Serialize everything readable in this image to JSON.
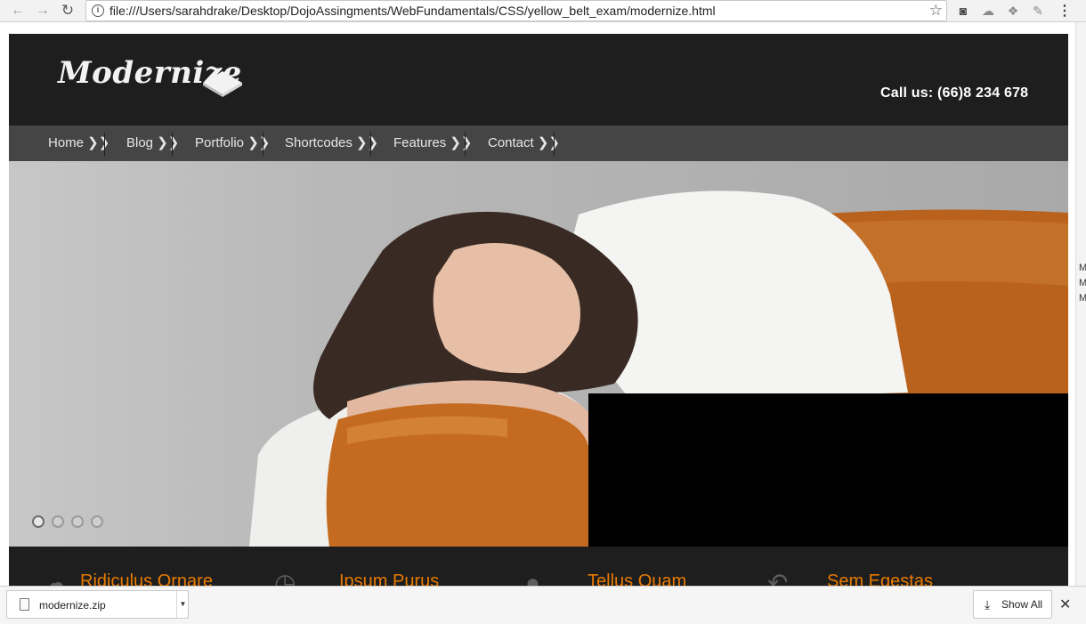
{
  "browser": {
    "url": "file:///Users/sarahdrake/Desktop/DojoAssingments/WebFundamentals/CSS/yellow_belt_exam/modernize.html",
    "back_icon": "back-arrow-icon",
    "forward_icon": "forward-arrow-icon",
    "reload_icon": "reload-icon"
  },
  "site": {
    "logo": "Modernize",
    "call_us": "Call us:  (66)8 234 678",
    "nav": [
      {
        "label": "Home ❯❯"
      },
      {
        "label": "Blog ❯❯"
      },
      {
        "label": "Portfolio ❯❯"
      },
      {
        "label": "Shortcodes ❯❯"
      },
      {
        "label": "Features ❯❯"
      },
      {
        "label": "Contact ❯❯"
      }
    ],
    "slider": {
      "slides": 4,
      "active": 1
    },
    "features": [
      {
        "icon": "cloud-icon",
        "title": "Ridiculus Ornare"
      },
      {
        "icon": "clock-icon",
        "title": "Ipsum Purus"
      },
      {
        "icon": "location-pin-icon",
        "title": "Tellus Quam"
      },
      {
        "icon": "undo-arrow-icon",
        "title": "Sem Egestas"
      }
    ]
  },
  "right_strip": [
    "M",
    "M",
    "M"
  ],
  "downloads": {
    "file_name": "modernize.zip",
    "show_all": "Show All",
    "close": "✕"
  },
  "colors": {
    "accent": "#e87a00",
    "header_bg": "#1e1e1e",
    "nav_bg": "#454545"
  }
}
